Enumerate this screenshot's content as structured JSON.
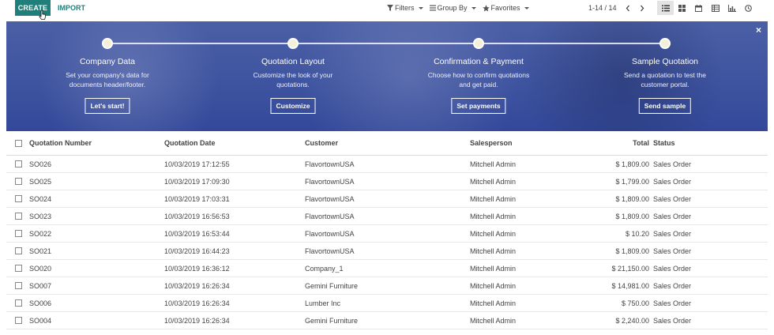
{
  "control_panel": {
    "create_label": "CREATE",
    "import_label": "IMPORT",
    "filters_label": "Filters",
    "group_by_label": "Group By",
    "favorites_label": "Favorites",
    "pager_text": "1-14 / 14"
  },
  "banner": {
    "steps": [
      {
        "title": "Company Data",
        "desc": "Set your company's data for documents header/footer.",
        "button": "Let's start!"
      },
      {
        "title": "Quotation Layout",
        "desc": "Customize the look of your quotations.",
        "button": "Customize"
      },
      {
        "title": "Confirmation & Payment",
        "desc": "Choose how to confirm quotations and get paid.",
        "button": "Set payments"
      },
      {
        "title": "Sample Quotation",
        "desc": "Send a quotation to test the customer portal.",
        "button": "Send sample"
      }
    ],
    "close_glyph": "×"
  },
  "table": {
    "headers": {
      "number": "Quotation Number",
      "date": "Quotation Date",
      "customer": "Customer",
      "salesperson": "Salesperson",
      "total": "Total",
      "status": "Status"
    },
    "rows": [
      {
        "number": "SO026",
        "date": "10/03/2019 17:12:55",
        "customer": "FlavortownUSA",
        "salesperson": "Mitchell Admin",
        "total": "$ 1,809.00",
        "status": "Sales Order"
      },
      {
        "number": "SO025",
        "date": "10/03/2019 17:09:30",
        "customer": "FlavortownUSA",
        "salesperson": "Mitchell Admin",
        "total": "$ 1,799.00",
        "status": "Sales Order"
      },
      {
        "number": "SO024",
        "date": "10/03/2019 17:03:31",
        "customer": "FlavortownUSA",
        "salesperson": "Mitchell Admin",
        "total": "$ 1,809.00",
        "status": "Sales Order"
      },
      {
        "number": "SO023",
        "date": "10/03/2019 16:56:53",
        "customer": "FlavortownUSA",
        "salesperson": "Mitchell Admin",
        "total": "$ 1,809.00",
        "status": "Sales Order"
      },
      {
        "number": "SO022",
        "date": "10/03/2019 16:53:44",
        "customer": "FlavortownUSA",
        "salesperson": "Mitchell Admin",
        "total": "$ 10.20",
        "status": "Sales Order"
      },
      {
        "number": "SO021",
        "date": "10/03/2019 16:44:23",
        "customer": "FlavortownUSA",
        "salesperson": "Mitchell Admin",
        "total": "$ 1,809.00",
        "status": "Sales Order"
      },
      {
        "number": "SO020",
        "date": "10/03/2019 16:36:12",
        "customer": "Company_1",
        "salesperson": "Mitchell Admin",
        "total": "$ 21,150.00",
        "status": "Sales Order"
      },
      {
        "number": "SO007",
        "date": "10/03/2019 16:26:34",
        "customer": "Gemini Furniture",
        "salesperson": "Mitchell Admin",
        "total": "$ 14,981.00",
        "status": "Sales Order"
      },
      {
        "number": "SO006",
        "date": "10/03/2019 16:26:34",
        "customer": "Lumber Inc",
        "salesperson": "Mitchell Admin",
        "total": "$ 750.00",
        "status": "Sales Order"
      },
      {
        "number": "SO004",
        "date": "10/03/2019 16:26:34",
        "customer": "Gemini Furniture",
        "salesperson": "Mitchell Admin",
        "total": "$ 2,240.00",
        "status": "Sales Order"
      }
    ]
  },
  "colors": {
    "brand": "#1e7f7b",
    "banner": "#3f54a0"
  }
}
